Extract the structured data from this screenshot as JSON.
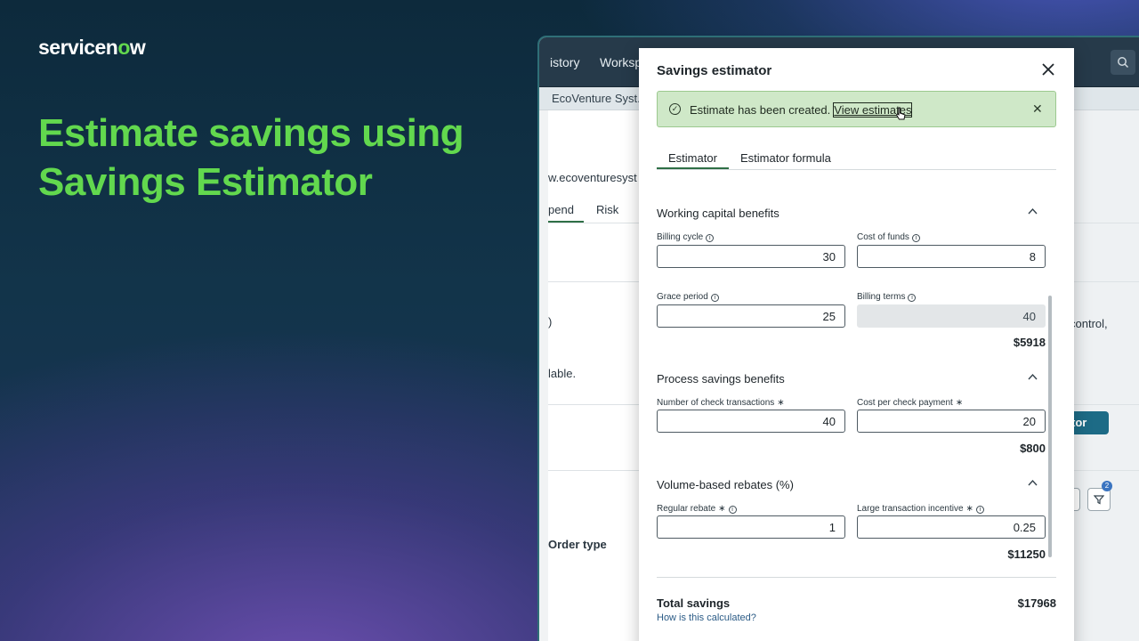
{
  "brand": {
    "logo_prefix": "servicen",
    "logo_o": "o",
    "logo_suffix": "w"
  },
  "headline": "Estimate savings using Savings Estimator",
  "background_app": {
    "nav_items": [
      "istory",
      "Worksp"
    ],
    "record_name": "EcoVenture Syst...",
    "website": "w.ecoventuresyst",
    "tabs": [
      "pend",
      "Risk"
    ],
    "fragment_paren": ")",
    "fragment_lable": "lable.",
    "fragment_control": "control,",
    "button_fragment": "tor",
    "order_type_label": "Order type",
    "filter_badge": "2"
  },
  "modal": {
    "title": "Savings estimator",
    "alert": {
      "text": "Estimate has been created.",
      "link": "View estimates"
    },
    "tabs": [
      {
        "label": "Estimator",
        "active": true
      },
      {
        "label": "Estimator formula",
        "active": false
      }
    ],
    "sections": {
      "working_capital": {
        "title": "Working capital benefits",
        "billing_cycle": {
          "label": "Billing cycle",
          "value": "30"
        },
        "cost_of_funds": {
          "label": "Cost of funds",
          "value": "8"
        },
        "grace_period": {
          "label": "Grace period",
          "value": "25"
        },
        "billing_terms": {
          "label": "Billing terms",
          "value": "40"
        },
        "subtotal": "$5918"
      },
      "process_savings": {
        "title": "Process savings benefits",
        "check_transactions": {
          "label": "Number of check transactions",
          "required_mark": "∗",
          "value": "40"
        },
        "cost_per_check": {
          "label": "Cost per check payment",
          "required_mark": "∗",
          "value": "20"
        },
        "subtotal": "$800"
      },
      "volume_rebates": {
        "title": "Volume-based rebates (%)",
        "regular_rebate": {
          "label": "Regular rebate",
          "required_mark": "∗",
          "value": "1"
        },
        "large_incentive": {
          "label": "Large transaction incentive",
          "required_mark": "∗",
          "value": "0.25"
        },
        "subtotal": "$11250"
      }
    },
    "total": {
      "label": "Total savings",
      "value": "$17968",
      "help_link": "How is this calculated?"
    }
  }
}
